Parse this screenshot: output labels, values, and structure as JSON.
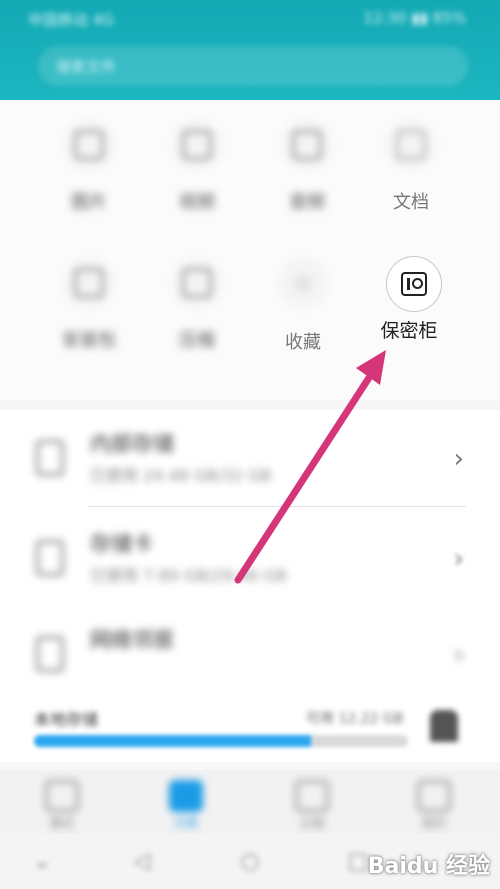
{
  "status_bar": {
    "left_text": "中国移动 4G",
    "right_text": "12:30 ▮▮ 85%"
  },
  "search": {
    "placeholder": "搜索文件"
  },
  "categories": [
    {
      "label": "图片"
    },
    {
      "label": "视频"
    },
    {
      "label": "音频"
    },
    {
      "label": "文档"
    },
    {
      "label": "安装包"
    },
    {
      "label": "压缩"
    },
    {
      "label": "收藏"
    },
    {
      "label": "保密柜"
    }
  ],
  "storage": [
    {
      "title": "内部存储",
      "subtitle": "已使用 24.48 GB/32 GB"
    },
    {
      "title": "存储卡",
      "subtitle": "已使用 7.89 GB/29.46 GB"
    },
    {
      "title": "网络邻居",
      "subtitle": ""
    }
  ],
  "cleanup": {
    "title": "本地存储",
    "value": "可用 12.22 GB",
    "progress_fraction": 0.74
  },
  "bottom_nav": [
    {
      "label": "最近"
    },
    {
      "label": "分类"
    },
    {
      "label": "云端"
    },
    {
      "label": "我的"
    }
  ],
  "watermark": "Baidu 经验",
  "colors": {
    "header": "#13a9b4",
    "accent": "#1a9be6",
    "annotation_arrow": "#d5367a"
  }
}
